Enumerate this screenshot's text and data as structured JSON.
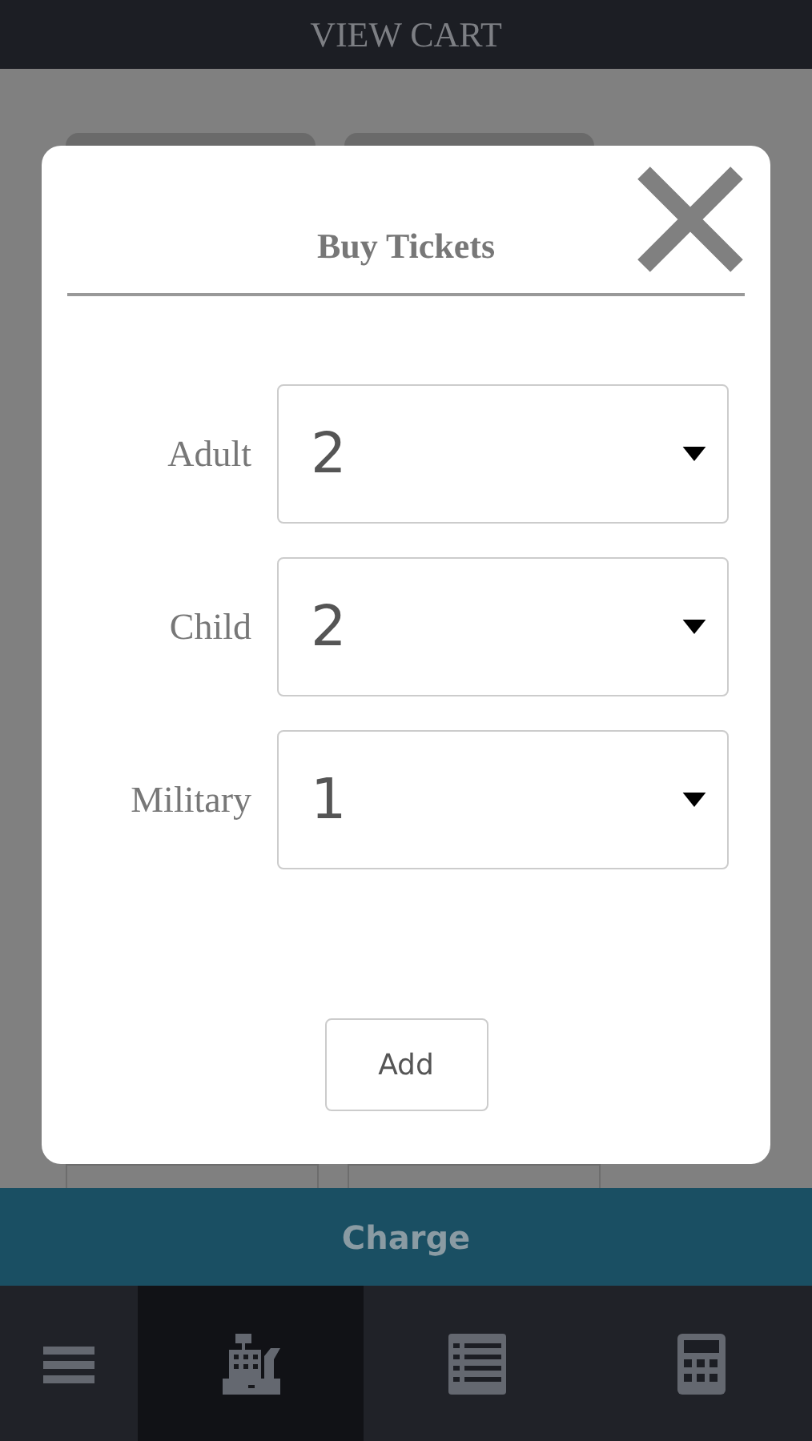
{
  "header": {
    "title": "VIEW CART"
  },
  "dialog": {
    "title": "Buy Tickets",
    "fields": [
      {
        "label": "Adult",
        "value": "2"
      },
      {
        "label": "Child",
        "value": "2"
      },
      {
        "label": "Military",
        "value": "1"
      }
    ],
    "add_button": "Add"
  },
  "charge_button": "Charge",
  "tabs": [
    {
      "kind": "menu",
      "selected": false
    },
    {
      "kind": "register",
      "selected": true
    },
    {
      "kind": "list",
      "selected": false
    },
    {
      "kind": "calculator",
      "selected": false
    }
  ]
}
